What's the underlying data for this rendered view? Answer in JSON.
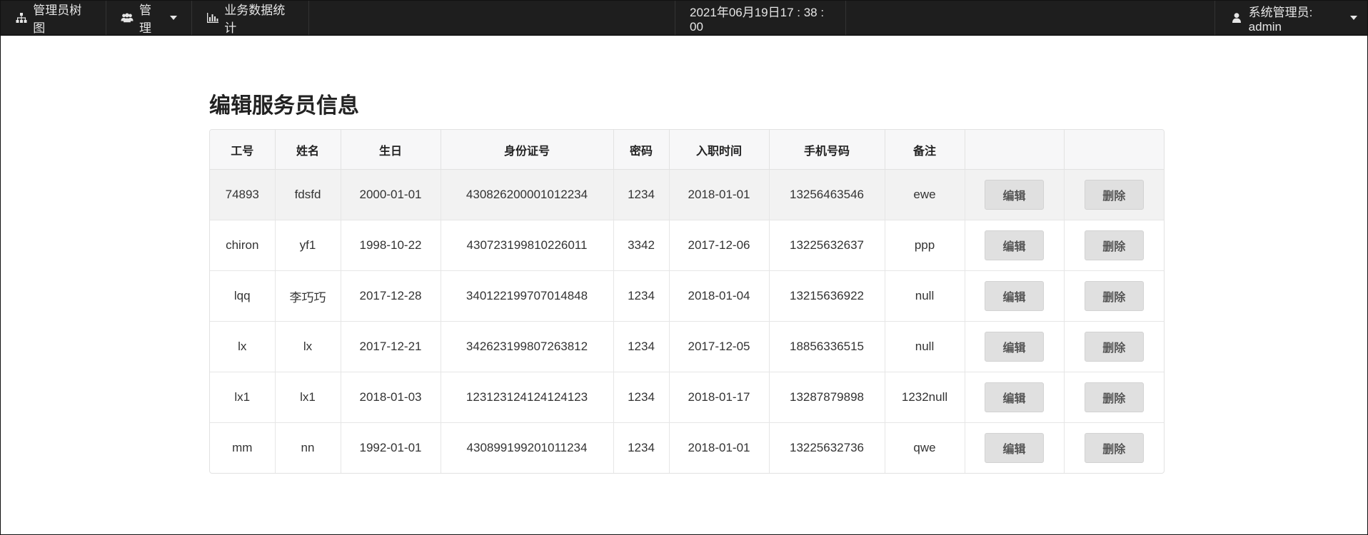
{
  "navbar": {
    "tree_label": "管理员树图",
    "manage_label": "管理",
    "stats_label": "业务数据统计",
    "datetime": "2021年06月19日17 : 38 : 00",
    "user_label": "系统管理员: admin"
  },
  "page": {
    "title": "编辑服务员信息"
  },
  "table": {
    "columns": [
      "工号",
      "姓名",
      "生日",
      "身份证号",
      "密码",
      "入职时间",
      "手机号码",
      "备注",
      "",
      ""
    ],
    "edit_label": "编辑",
    "delete_label": "删除",
    "rows": [
      {
        "id": "74893",
        "name": "fdsfd",
        "birthday": "2000-01-01",
        "id_card": "430826200001012234",
        "password": "1234",
        "hire_date": "2018-01-01",
        "phone": "13256463546",
        "remark": "ewe"
      },
      {
        "id": "chiron",
        "name": "yf1",
        "birthday": "1998-10-22",
        "id_card": "430723199810226011",
        "password": "3342",
        "hire_date": "2017-12-06",
        "phone": "13225632637",
        "remark": "ppp"
      },
      {
        "id": "lqq",
        "name": "李巧巧",
        "birthday": "2017-12-28",
        "id_card": "340122199707014848",
        "password": "1234",
        "hire_date": "2018-01-04",
        "phone": "13215636922",
        "remark": "null"
      },
      {
        "id": "lx",
        "name": "lx",
        "birthday": "2017-12-21",
        "id_card": "342623199807263812",
        "password": "1234",
        "hire_date": "2017-12-05",
        "phone": "18856336515",
        "remark": "null"
      },
      {
        "id": "lx1",
        "name": "lx1",
        "birthday": "2018-01-03",
        "id_card": "123123124124124123",
        "password": "1234",
        "hire_date": "2018-01-17",
        "phone": "13287879898",
        "remark": "1232null"
      },
      {
        "id": "mm",
        "name": "nn",
        "birthday": "1992-01-01",
        "id_card": "430899199201011234",
        "password": "1234",
        "hire_date": "2018-01-01",
        "phone": "13225632736",
        "remark": "qwe"
      }
    ]
  },
  "icons": {
    "tree": "sitemap-icon",
    "manage": "users-icon",
    "stats": "bar-chart-icon",
    "user": "user-icon"
  },
  "colors": {
    "navbar_bg": "#1e1e1e",
    "button_bg": "#e0e0e0",
    "header_bg": "#f7f7f8",
    "highlight_row": "#f2f2f2"
  }
}
